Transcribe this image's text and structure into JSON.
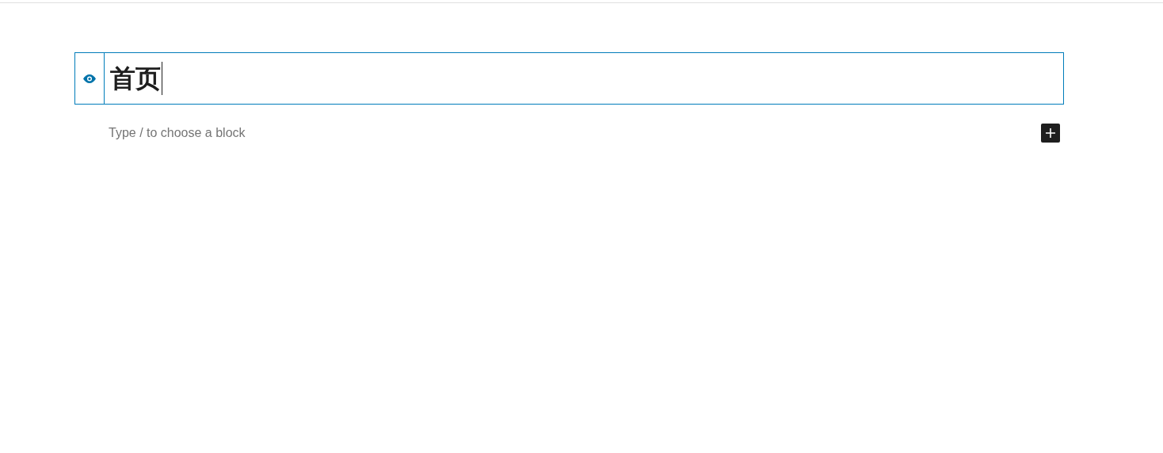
{
  "title_block": {
    "value": "首页"
  },
  "paragraph": {
    "placeholder": "Type / to choose a block"
  }
}
